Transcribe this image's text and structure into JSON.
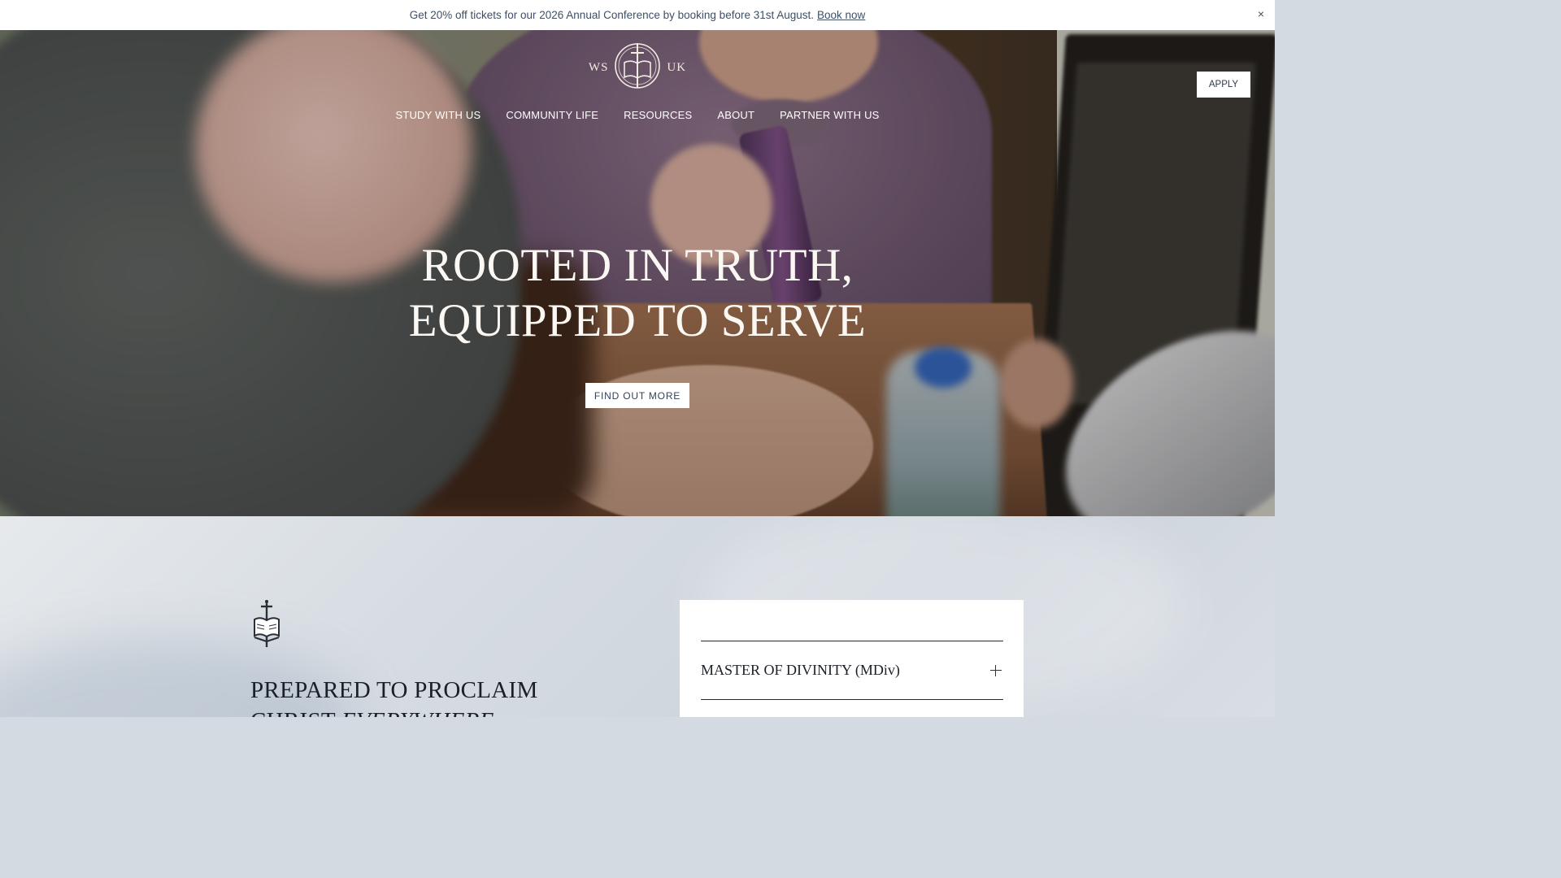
{
  "announcement": {
    "text": "Get 20% off tickets for our 2026 Annual Conference by booking before 31st August.",
    "link_label": "Book now",
    "close_label": "×"
  },
  "header": {
    "logo_left": "WS",
    "logo_right": "UK",
    "apply_label": "APPLY",
    "nav": [
      "STUDY WITH US",
      "COMMUNITY LIFE",
      "RESOURCES",
      "ABOUT",
      "PARTNER WITH US"
    ]
  },
  "hero": {
    "headline_line1": "ROOTED IN TRUTH,",
    "headline_line2": "EQUIPPED TO SERVE",
    "cta_label": "FIND OUT MORE"
  },
  "section": {
    "title_line1": "PREPARED TO PROCLAIM",
    "title_line2_plain": "CHRIST ",
    "title_line2_italic": "EVERYWHERE"
  },
  "programs": {
    "items": [
      {
        "label": "MASTER OF DIVINITY (MDiv)"
      }
    ]
  },
  "icons": {
    "close": "close-icon",
    "emblem": "sword-book-icon",
    "expand": "plus-icon"
  },
  "colors": {
    "announcement_text": "#3f4f66",
    "button_text": "#344257",
    "heading_dark": "#1b1f27"
  }
}
